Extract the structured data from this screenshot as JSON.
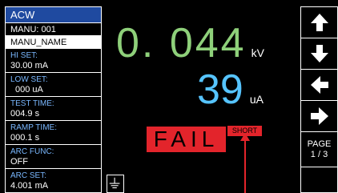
{
  "sidebar": {
    "title": "ACW",
    "manu": "MANU: 001",
    "manu_name": "MANU_NAME",
    "items": [
      {
        "label": "HI SET:",
        "value": "30.00 mA"
      },
      {
        "label": "LOW SET:",
        "value": "000 uA"
      },
      {
        "label": "TEST TIME:",
        "value": "004.9 s"
      },
      {
        "label": "RAMP TIME:",
        "value": "000.1 s"
      },
      {
        "label": "ARC FUNC:",
        "value": "OFF"
      },
      {
        "label": "ARC SET:",
        "value": "4.001 mA"
      }
    ]
  },
  "display": {
    "voltage": "0. 044",
    "voltage_unit": "kV",
    "current": "39",
    "current_unit": "uA",
    "result": "FAIL",
    "result_detail": "SHORT"
  },
  "nav": {
    "page_label": "PAGE",
    "page_value": "1 / 3"
  },
  "icons": {
    "up": "arrow-up-icon",
    "down": "arrow-down-icon",
    "left": "arrow-left-icon",
    "right": "arrow-right-icon",
    "ground": "ground-icon"
  },
  "colors": {
    "voltage": "#8ed07a",
    "current": "#56c4ff",
    "fail": "#e3242b",
    "sidebar_title_bg": "#1f4aa0"
  }
}
